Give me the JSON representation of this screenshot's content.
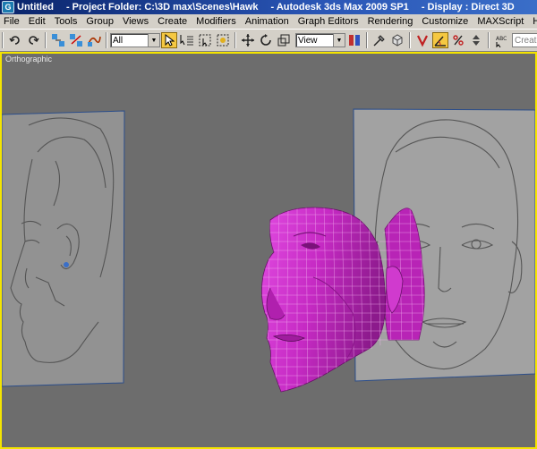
{
  "titlebar": {
    "app_name": "Untitled",
    "project_folder": "- Project Folder: C:\\3D max\\Scenes\\Hawk",
    "application": "- Autodesk 3ds Max  2009 SP1",
    "display": "- Display : Direct 3D"
  },
  "menu": [
    "File",
    "Edit",
    "Tools",
    "Group",
    "Views",
    "Create",
    "Modifiers",
    "Animation",
    "Graph Editors",
    "Rendering",
    "Customize",
    "MAXScript",
    "Help"
  ],
  "toolbar": {
    "selection_filter": "All",
    "reference_coord": "View",
    "named_selection_placeholder": "Create Selection",
    "icons": [
      "undo-icon",
      "redo-icon",
      "select-and-link-icon",
      "unlink-icon",
      "bind-to-space-warp-icon",
      "select-object-icon",
      "select-by-name-icon",
      "rectangular-selection-icon",
      "window-crossing-icon",
      "move-icon",
      "rotate-icon",
      "scale-icon",
      "pivot-center-icon",
      "mirror-icon",
      "align-icon",
      "snap-toggle-icon",
      "angle-snap-icon",
      "percent-snap-icon",
      "spinner-snap-icon",
      "edit-named-selection-icon"
    ]
  },
  "viewport": {
    "label": "Orthographic",
    "active_border_color": "#f4e400",
    "mesh_color": "#c62ac4"
  }
}
